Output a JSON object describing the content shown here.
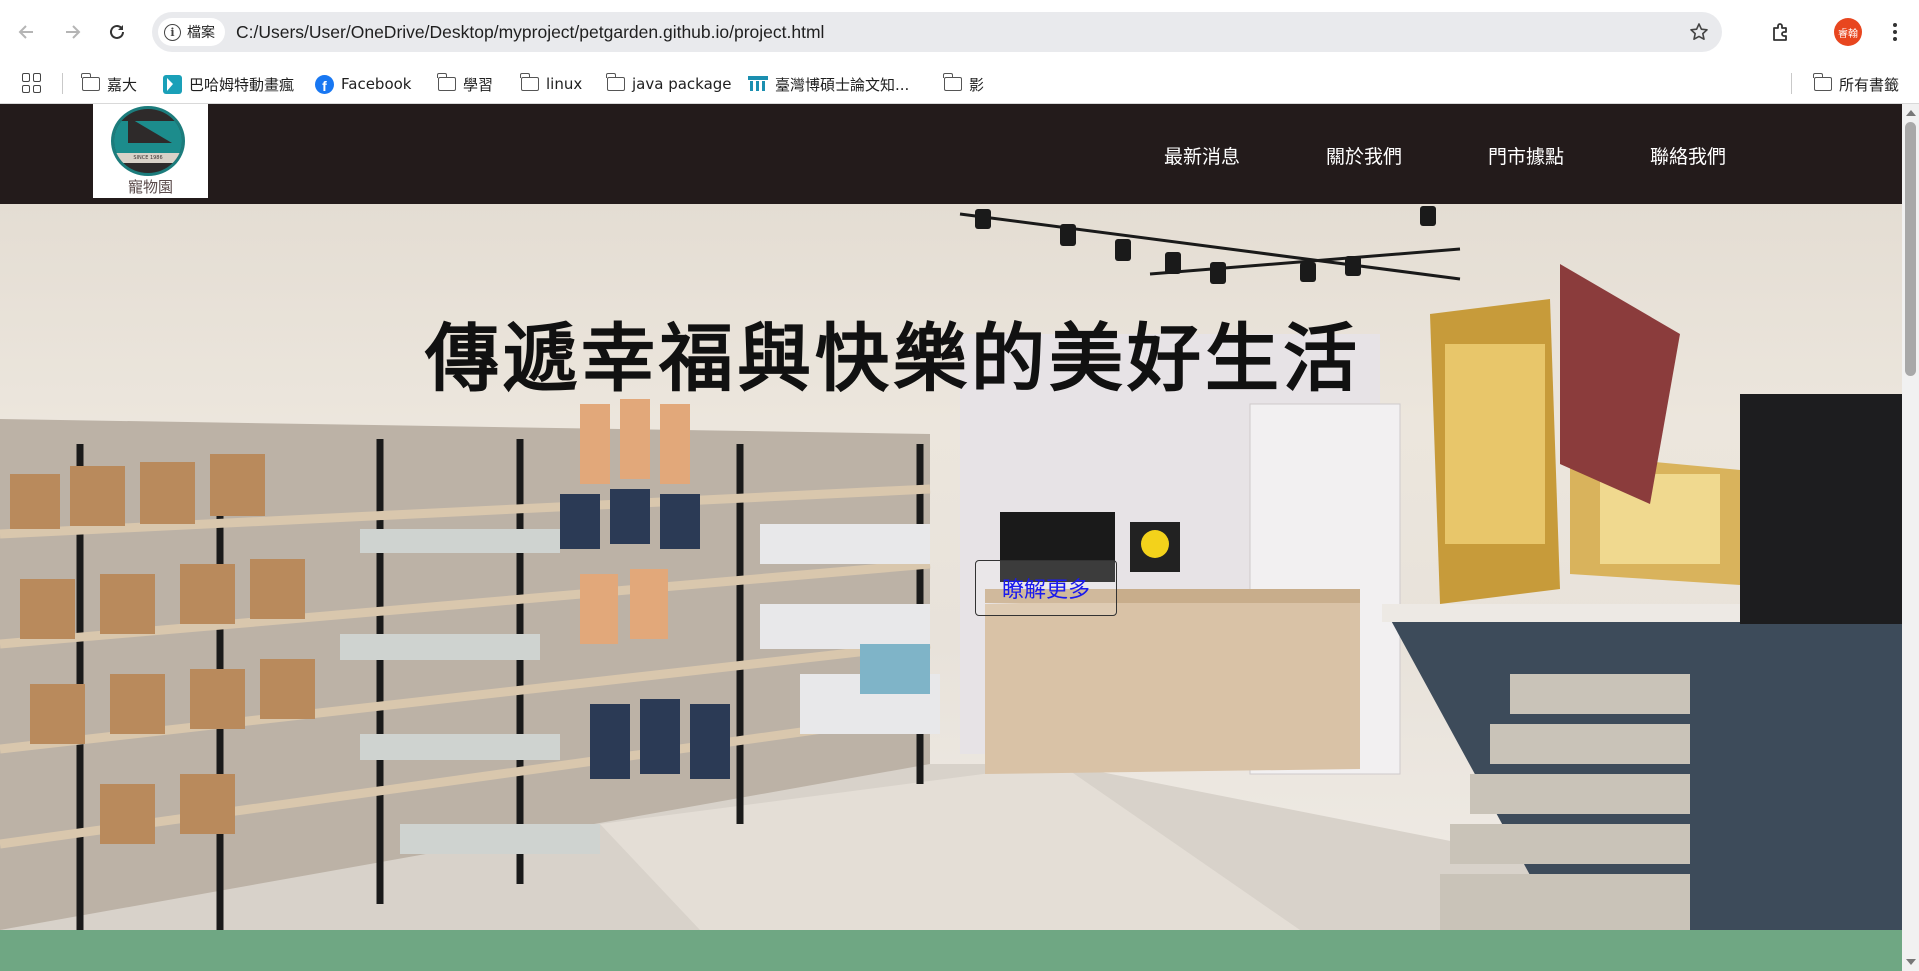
{
  "browser": {
    "site_chip_label": "檔案",
    "url": "C:/Users/User/OneDrive/Desktop/myproject/petgarden.github.io/project.html",
    "profile_label": "睿翰",
    "icons": [
      "back-arrow-icon",
      "forward-arrow-icon",
      "reload-icon",
      "info-icon",
      "star-icon",
      "extensions-icon",
      "kebab-menu-icon"
    ]
  },
  "bookmarks": {
    "items": [
      {
        "label": "嘉大",
        "icon": "folder-icon"
      },
      {
        "label": "巴哈姆特動畫瘋",
        "icon": "bahamut-icon"
      },
      {
        "label": "Facebook",
        "icon": "facebook-icon"
      },
      {
        "label": "學習",
        "icon": "folder-icon"
      },
      {
        "label": "linux",
        "icon": "folder-icon"
      },
      {
        "label": "java package",
        "icon": "folder-icon"
      },
      {
        "label": "臺灣博碩士論文知...",
        "icon": "ndltd-icon"
      },
      {
        "label": "影",
        "icon": "folder-icon"
      }
    ],
    "all_bookmarks_label": "所有書籤"
  },
  "site": {
    "logo_text": "寵物園",
    "logo_badge_text": "SINCE 1986",
    "nav": [
      "最新消息",
      "關於我們",
      "門市據點",
      "聯絡我們"
    ],
    "colors": {
      "header_bg": "#231b1b",
      "band": "#6fa783",
      "button_text": "#1a1aee"
    }
  },
  "hero": {
    "title": "傳遞幸福與快樂的美好生活",
    "button_label": "瞭解更多"
  }
}
